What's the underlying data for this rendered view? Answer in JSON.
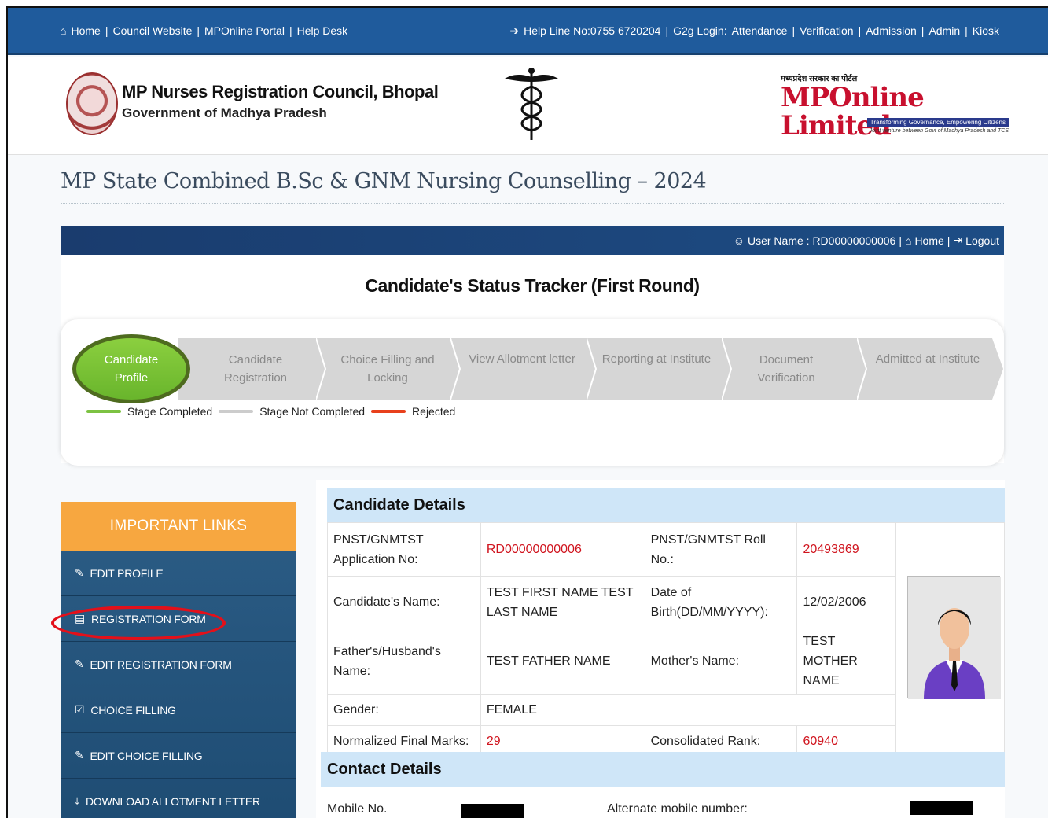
{
  "topbar": {
    "links": [
      "Home",
      "Council Website",
      "MPOnline Portal",
      "Help Desk"
    ],
    "helpline": "Help Line No:0755 6720204",
    "g2g_label": "G2g Login:",
    "right_links": [
      "Attendance",
      "Verification",
      "Admission",
      "Admin",
      "Kiosk"
    ]
  },
  "header": {
    "council_name": "MP Nurses Registration Council, Bhopal",
    "government": "Government of Madhya Pradesh",
    "mponline_hindi": "मध्यप्रदेश सरकार का पोर्टल",
    "mponline_logo": "MPOnline Limited",
    "mponline_tagline": "Transforming Governance, Empowering Citizens",
    "mponline_jv": "Joint venture between Govt of Madhya Pradesh and TCS"
  },
  "page_title": "MP State Combined B.Sc & GNM Nursing Counselling – 2024",
  "userbar": {
    "user_label": "User Name : RD00000000006",
    "home": "Home",
    "logout": "Logout"
  },
  "status": {
    "title": "Candidate's Status Tracker (First Round)",
    "steps": [
      {
        "label": "Candidate Profile",
        "state": "completed"
      },
      {
        "label": "Candidate Registration",
        "state": "not-completed"
      },
      {
        "label": "Choice Filling and Locking",
        "state": "not-completed"
      },
      {
        "label": "View Allotment letter",
        "state": "not-completed"
      },
      {
        "label": "Reporting at Institute",
        "state": "not-completed"
      },
      {
        "label": "Document Verification",
        "state": "not-completed"
      },
      {
        "label": "Admitted at Institute",
        "state": "not-completed"
      }
    ],
    "legend": [
      {
        "label": "Stage Completed",
        "color": "#7cc242"
      },
      {
        "label": "Stage Not Completed",
        "color": "#cccccc"
      },
      {
        "label": "Rejected",
        "color": "#e8401c"
      }
    ]
  },
  "sidebar": {
    "heading": "IMPORTANT LINKS",
    "items": [
      {
        "label": "EDIT PROFILE",
        "icon": "edit-icon"
      },
      {
        "label": "REGISTRATION FORM",
        "icon": "id-card-icon"
      },
      {
        "label": "EDIT REGISTRATION FORM",
        "icon": "edit-icon"
      },
      {
        "label": "CHOICE FILLING",
        "icon": "checkbox-icon"
      },
      {
        "label": "EDIT CHOICE FILLING",
        "icon": "edit-icon"
      },
      {
        "label": "DOWNLOAD ALLOTMENT LETTER",
        "icon": "download-icon"
      }
    ]
  },
  "candidate": {
    "heading": "Candidate Details",
    "app_no_label": "PNST/GNMTST Application No:",
    "app_no": "RD00000000006",
    "roll_label": "PNST/GNMTST Roll No.:",
    "roll": "20493869",
    "name_label": "Candidate's Name:",
    "name": "TEST FIRST NAME TEST LAST NAME",
    "dob_label": "Date of Birth(DD/MM/YYYY):",
    "dob": "12/02/2006",
    "father_label": "Father's/Husband's Name:",
    "father": "TEST FATHER NAME",
    "mother_label": "Mother's Name:",
    "mother": "TEST MOTHER NAME",
    "gender_label": "Gender:",
    "gender": "FEMALE",
    "marks_label": "Normalized Final Marks:",
    "marks": "29",
    "rank_label": "Consolidated Rank:",
    "rank": "60940"
  },
  "contact": {
    "heading": "Contact Details",
    "mobile_label": "Mobile No.",
    "alt_mobile_label": "Alternate mobile number:"
  },
  "colors": {
    "topbar": "#1f5b9c",
    "accent_orange": "#f7a740",
    "completed_green": "#7cc242",
    "highlight_red": "#e3101a",
    "value_red": "#d0141e"
  }
}
